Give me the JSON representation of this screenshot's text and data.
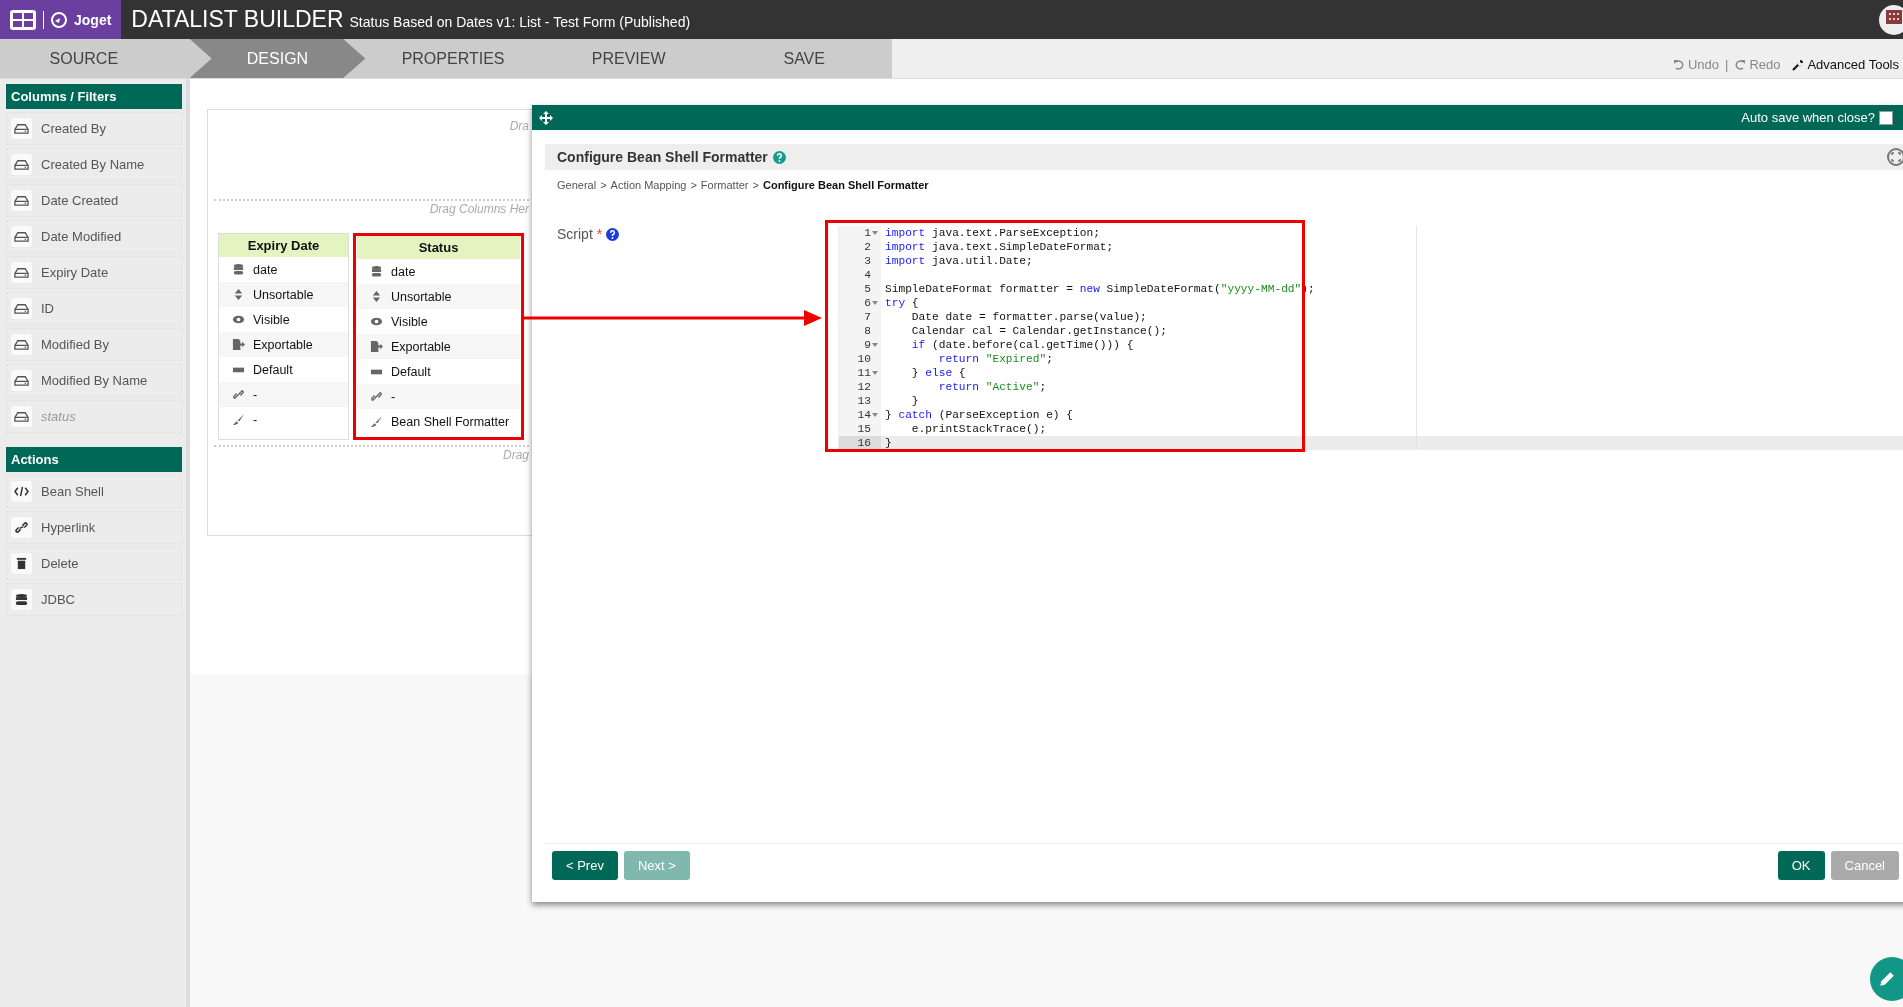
{
  "header": {
    "logo": "Joget",
    "title": "DATALIST BUILDER",
    "subtitle": "Status Based on Dates v1: List - Test Form (Published)"
  },
  "tabs": [
    {
      "label": "SOURCE",
      "selected": false
    },
    {
      "label": "DESIGN",
      "selected": true
    },
    {
      "label": "PROPERTIES",
      "selected": false
    },
    {
      "label": "PREVIEW",
      "selected": false
    },
    {
      "label": "SAVE",
      "selected": false
    }
  ],
  "toolbar": {
    "undo": {
      "label": "Undo",
      "disabled": true
    },
    "separator": "|",
    "redo": {
      "label": "Redo",
      "disabled": true
    },
    "advanced": "Advanced Tools"
  },
  "sidebar": {
    "sections": [
      {
        "title": "Columns / Filters",
        "kind": "columns",
        "items": [
          {
            "label": "Created By",
            "muted": false
          },
          {
            "label": "Created By Name",
            "muted": false
          },
          {
            "label": "Date Created",
            "muted": false
          },
          {
            "label": "Date Modified",
            "muted": false
          },
          {
            "label": "Expiry Date",
            "muted": false
          },
          {
            "label": "ID",
            "muted": false
          },
          {
            "label": "Modified By",
            "muted": false
          },
          {
            "label": "Modified By Name",
            "muted": false
          },
          {
            "label": "status",
            "muted": true
          }
        ]
      },
      {
        "title": "Actions",
        "kind": "actions",
        "items": [
          {
            "label": "Bean Shell",
            "muted": false
          },
          {
            "label": "Hyperlink",
            "muted": false
          },
          {
            "label": "Delete",
            "muted": false
          },
          {
            "label": "JDBC",
            "muted": false
          }
        ]
      }
    ]
  },
  "canvas": {
    "top_hint": "Dra",
    "columns_hint": "Drag Columns Her",
    "bottom_hint": "Drag",
    "columns": [
      {
        "title": "Expiry Date",
        "selected": false,
        "properties": [
          "date",
          "Unsortable",
          "Visible",
          "Exportable",
          "Default",
          "-",
          "-"
        ]
      },
      {
        "title": "Status",
        "selected": true,
        "properties": [
          "date",
          "Unsortable",
          "Visible",
          "Exportable",
          "Default",
          "-",
          "Bean Shell Formatter"
        ]
      }
    ]
  },
  "dialog": {
    "auto_save": {
      "label": "Auto save when close?",
      "checked": false
    },
    "title": "Configure Bean Shell Formatter",
    "breadcrumb": [
      "General",
      ">",
      "Action Mapping",
      ">",
      "Formatter",
      ">",
      "Configure Bean Shell Formatter"
    ],
    "field": {
      "label": "Script",
      "required_mark": "*"
    },
    "code": [
      {
        "number": "1",
        "fold": true,
        "active": false,
        "tokens": [
          {
            "text": "import",
            "kind": "keyword"
          },
          {
            "text": " java.text.ParseException;",
            "kind": "plain"
          }
        ]
      },
      {
        "number": "2",
        "fold": false,
        "active": false,
        "tokens": [
          {
            "text": "import",
            "kind": "keyword"
          },
          {
            "text": " java.text.SimpleDateFormat;",
            "kind": "plain"
          }
        ]
      },
      {
        "number": "3",
        "fold": false,
        "active": false,
        "tokens": [
          {
            "text": "import",
            "kind": "keyword"
          },
          {
            "text": " java.util.Date;",
            "kind": "plain"
          }
        ]
      },
      {
        "number": "4",
        "fold": false,
        "active": false
      },
      {
        "number": "5",
        "fold": false,
        "active": false,
        "tokens": [
          {
            "text": "SimpleDateFormat formatter = ",
            "kind": "plain"
          },
          {
            "text": "new",
            "kind": "keyword"
          },
          {
            "text": " SimpleDateFormat(",
            "kind": "plain"
          },
          {
            "text": "\"yyyy-MM-dd\"",
            "kind": "string"
          },
          {
            "text": ");",
            "kind": "plain"
          }
        ]
      },
      {
        "number": "6",
        "fold": true,
        "active": false,
        "tokens": [
          {
            "text": "try",
            "kind": "keyword"
          },
          {
            "text": " {",
            "kind": "plain"
          }
        ]
      },
      {
        "number": "7",
        "fold": false,
        "active": false,
        "tokens": [
          {
            "text": "    Date date = formatter.parse(value);",
            "kind": "plain"
          }
        ]
      },
      {
        "number": "8",
        "fold": false,
        "active": false,
        "tokens": [
          {
            "text": "    Calendar cal = Calendar.getInstance();",
            "kind": "plain"
          }
        ]
      },
      {
        "number": "9",
        "fold": true,
        "active": false,
        "tokens": [
          {
            "text": "    if",
            "kind": "keyword"
          },
          {
            "text": " (date.before(cal.getTime())) {",
            "kind": "plain"
          }
        ]
      },
      {
        "number": "10",
        "fold": false,
        "active": false,
        "tokens": [
          {
            "text": "        return",
            "kind": "keyword"
          },
          {
            "text": " \"Expired\"",
            "kind": "string"
          },
          {
            "text": ";",
            "kind": "plain"
          }
        ]
      },
      {
        "number": "11",
        "fold": true,
        "active": false,
        "tokens": [
          {
            "text": "    } ",
            "kind": "plain"
          },
          {
            "text": "else",
            "kind": "keyword"
          },
          {
            "text": " {",
            "kind": "plain"
          }
        ]
      },
      {
        "number": "12",
        "fold": false,
        "active": false,
        "tokens": [
          {
            "text": "        return",
            "kind": "keyword"
          },
          {
            "text": " \"Active\"",
            "kind": "string"
          },
          {
            "text": ";",
            "kind": "plain"
          }
        ]
      },
      {
        "number": "13",
        "fold": false,
        "active": false,
        "tokens": [
          {
            "text": "    }",
            "kind": "plain"
          }
        ]
      },
      {
        "number": "14",
        "fold": true,
        "active": false,
        "tokens": [
          {
            "text": "} ",
            "kind": "plain"
          },
          {
            "text": "catch",
            "kind": "keyword"
          },
          {
            "text": " (ParseException e) {",
            "kind": "plain"
          }
        ]
      },
      {
        "number": "15",
        "fold": false,
        "active": false,
        "tokens": [
          {
            "text": "    e.printStackTrace();",
            "kind": "plain"
          }
        ]
      },
      {
        "number": "16",
        "fold": false,
        "active": true,
        "tokens": [
          {
            "text": "}",
            "kind": "plain"
          }
        ]
      }
    ],
    "buttons": [
      {
        "label": "< Prev",
        "kind": "primary",
        "disabled": false
      },
      {
        "label": "Next >",
        "kind": "primary",
        "disabled": true
      },
      {
        "label": "OK",
        "kind": "primary",
        "disabled": false
      },
      {
        "label": "Cancel",
        "kind": "secondary",
        "disabled": false
      }
    ]
  }
}
